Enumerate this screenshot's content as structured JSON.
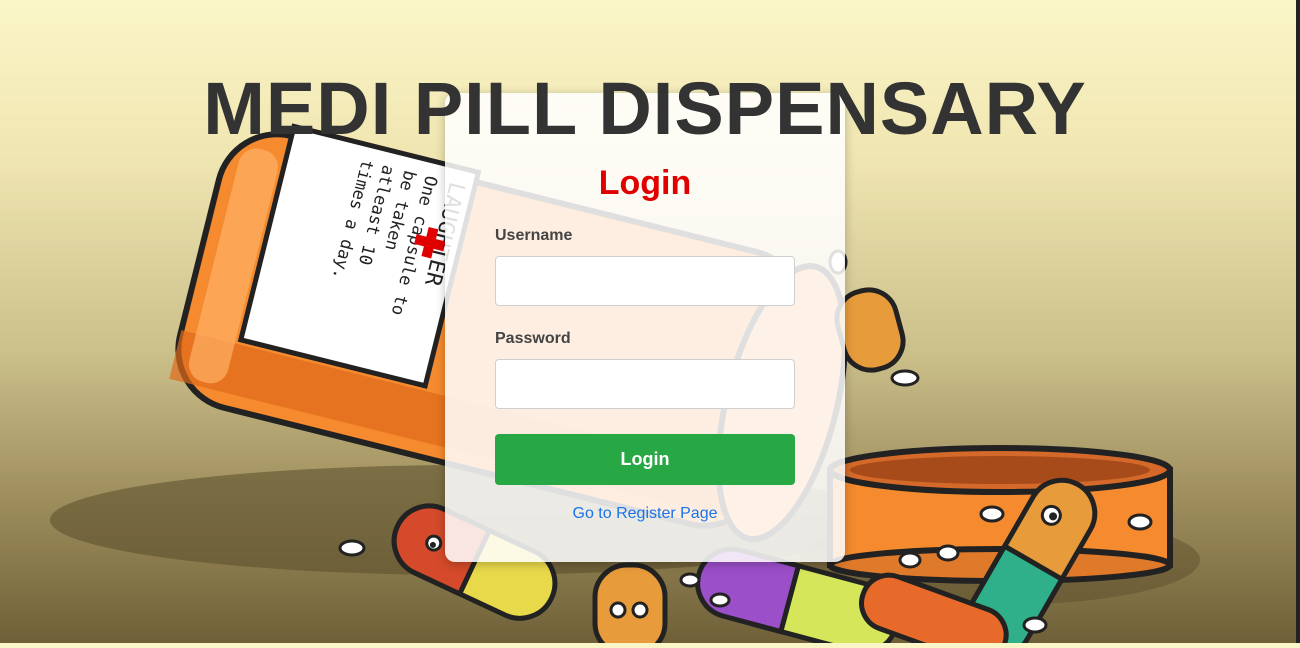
{
  "header": {
    "title": "MEDI PILL DISPENSARY"
  },
  "login": {
    "heading": "Login",
    "username_label": "Username",
    "username_value": "",
    "password_label": "Password",
    "password_value": "",
    "submit_label": "Login",
    "register_link": "Go to Register Page"
  },
  "background": {
    "bottle_label_lines": [
      "LAUGHTER",
      "One capsule to",
      "be taken",
      "atleast 10",
      "times a day."
    ]
  },
  "colors": {
    "title": "#333333",
    "heading": "#e00000",
    "button": "#28a745",
    "link": "#1a73e8",
    "bottle": "#f58a2e"
  }
}
